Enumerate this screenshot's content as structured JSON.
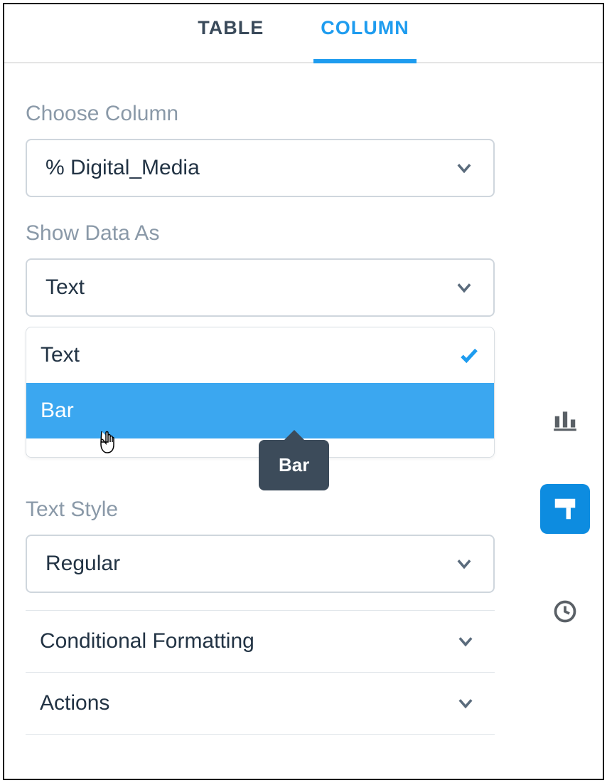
{
  "tabs": {
    "table": "TABLE",
    "column": "COLUMN"
  },
  "choose_column": {
    "label": "Choose Column",
    "value": "% Digital_Media"
  },
  "show_data_as": {
    "label": "Show Data As",
    "value": "Text",
    "options": [
      "Text",
      "Bar"
    ],
    "highlighted": "Bar",
    "tooltip": "Bar"
  },
  "text_style": {
    "label": "Text Style",
    "value": "Regular"
  },
  "accordions": {
    "conditional_formatting": "Conditional Formatting",
    "actions": "Actions"
  }
}
